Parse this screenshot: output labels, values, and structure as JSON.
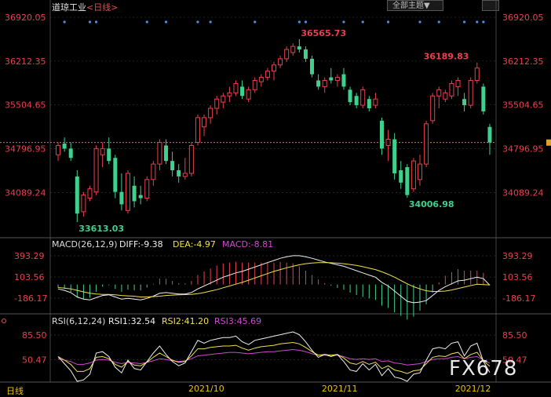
{
  "header": {
    "instrument": "道琼工业",
    "period": "<日线>",
    "theme_button": "全部主题▼"
  },
  "colors": {
    "up": "#e8414e",
    "down": "#3fd08d",
    "price_axis": "#e8414e",
    "grid": "#3a3a3a",
    "dots": "#4a90e2",
    "diff": "#f0f0f0",
    "dea": "#f2e14a",
    "rsi1": "#f0f0f0",
    "rsi2": "#f2e14a",
    "rsi3": "#d04ad0"
  },
  "footer": {
    "period_label": "日线",
    "watermark": "FX678"
  },
  "chart_data": [
    {
      "type": "candlestick",
      "panel": "price",
      "y_ticks": [
        "36920.05",
        "36212.35",
        "35504.65",
        "34796.95",
        "34089.24"
      ],
      "ylim": [
        33500,
        36920
      ],
      "x_ticks": [
        "2021/10",
        "2021/11",
        "2021/12"
      ],
      "last_close": 34897,
      "annotations": [
        {
          "text": "36565.73",
          "index": 38,
          "value": 36565.73,
          "kind": "high"
        },
        {
          "text": "33613.03",
          "index": 3,
          "value": 33613.03,
          "kind": "low"
        },
        {
          "text": "34006.98",
          "index": 55,
          "value": 34006.98,
          "kind": "low"
        },
        {
          "text": "36189.83",
          "index": 65,
          "value": 36189.83,
          "kind": "high"
        }
      ],
      "signal_dots": [
        1,
        5,
        6,
        14,
        17,
        22,
        24,
        31,
        38,
        39,
        45,
        48,
        52,
        57,
        60,
        64,
        66,
        67
      ],
      "candles": [
        {
          "o": 34700,
          "h": 34900,
          "l": 34600,
          "c": 34850
        },
        {
          "o": 34880,
          "h": 34980,
          "l": 34750,
          "c": 34800
        },
        {
          "o": 34800,
          "h": 34900,
          "l": 34600,
          "c": 34650
        },
        {
          "o": 34350,
          "h": 34450,
          "l": 33613,
          "c": 33750
        },
        {
          "o": 33780,
          "h": 34100,
          "l": 33700,
          "c": 34050
        },
        {
          "o": 34000,
          "h": 34200,
          "l": 33950,
          "c": 34150
        },
        {
          "o": 34100,
          "h": 34850,
          "l": 34050,
          "c": 34800
        },
        {
          "o": 34700,
          "h": 34900,
          "l": 34500,
          "c": 34800
        },
        {
          "o": 34800,
          "h": 34980,
          "l": 34550,
          "c": 34600
        },
        {
          "o": 34650,
          "h": 34700,
          "l": 34000,
          "c": 34100
        },
        {
          "o": 34100,
          "h": 34400,
          "l": 33800,
          "c": 33900
        },
        {
          "o": 33800,
          "h": 34450,
          "l": 33750,
          "c": 34400
        },
        {
          "o": 34200,
          "h": 34350,
          "l": 33850,
          "c": 33950
        },
        {
          "o": 34050,
          "h": 34200,
          "l": 33900,
          "c": 34000
        },
        {
          "o": 34000,
          "h": 34350,
          "l": 33950,
          "c": 34300
        },
        {
          "o": 34300,
          "h": 34600,
          "l": 34200,
          "c": 34550
        },
        {
          "o": 34550,
          "h": 34950,
          "l": 34450,
          "c": 34900
        },
        {
          "o": 34850,
          "h": 34950,
          "l": 34550,
          "c": 34600
        },
        {
          "o": 34600,
          "h": 34750,
          "l": 34350,
          "c": 34450
        },
        {
          "o": 34450,
          "h": 34550,
          "l": 34250,
          "c": 34350
        },
        {
          "o": 34350,
          "h": 34650,
          "l": 34300,
          "c": 34400
        },
        {
          "o": 34400,
          "h": 34900,
          "l": 34350,
          "c": 34850
        },
        {
          "o": 34900,
          "h": 35350,
          "l": 34850,
          "c": 35300
        },
        {
          "o": 35150,
          "h": 35350,
          "l": 35000,
          "c": 35300
        },
        {
          "o": 35300,
          "h": 35500,
          "l": 35200,
          "c": 35450
        },
        {
          "o": 35450,
          "h": 35650,
          "l": 35350,
          "c": 35600
        },
        {
          "o": 35550,
          "h": 35700,
          "l": 35450,
          "c": 35650
        },
        {
          "o": 35650,
          "h": 35800,
          "l": 35550,
          "c": 35700
        },
        {
          "o": 35700,
          "h": 35900,
          "l": 35650,
          "c": 35850
        },
        {
          "o": 35800,
          "h": 35900,
          "l": 35600,
          "c": 35650
        },
        {
          "o": 35600,
          "h": 35800,
          "l": 35550,
          "c": 35750
        },
        {
          "o": 35750,
          "h": 35950,
          "l": 35700,
          "c": 35900
        },
        {
          "o": 35880,
          "h": 36000,
          "l": 35800,
          "c": 35950
        },
        {
          "o": 35950,
          "h": 36100,
          "l": 35900,
          "c": 36050
        },
        {
          "o": 36050,
          "h": 36200,
          "l": 35900,
          "c": 36150
        },
        {
          "o": 36150,
          "h": 36300,
          "l": 36100,
          "c": 36250
        },
        {
          "o": 36250,
          "h": 36450,
          "l": 36200,
          "c": 36400
        },
        {
          "o": 36350,
          "h": 36500,
          "l": 36300,
          "c": 36450
        },
        {
          "o": 36450,
          "h": 36565.73,
          "l": 36350,
          "c": 36400
        },
        {
          "o": 36400,
          "h": 36450,
          "l": 36200,
          "c": 36250
        },
        {
          "o": 36250,
          "h": 36300,
          "l": 35950,
          "c": 36000
        },
        {
          "o": 35900,
          "h": 36000,
          "l": 35750,
          "c": 35800
        },
        {
          "o": 35800,
          "h": 35950,
          "l": 35700,
          "c": 35900
        },
        {
          "o": 35950,
          "h": 36100,
          "l": 35850,
          "c": 35900
        },
        {
          "o": 35900,
          "h": 36000,
          "l": 35800,
          "c": 35950
        },
        {
          "o": 36000,
          "h": 36100,
          "l": 35750,
          "c": 35800
        },
        {
          "o": 35750,
          "h": 35800,
          "l": 35500,
          "c": 35550
        },
        {
          "o": 35650,
          "h": 35700,
          "l": 35450,
          "c": 35500
        },
        {
          "o": 35500,
          "h": 35800,
          "l": 35450,
          "c": 35750
        },
        {
          "o": 35600,
          "h": 35650,
          "l": 35400,
          "c": 35450
        },
        {
          "o": 35500,
          "h": 35700,
          "l": 35450,
          "c": 35600
        },
        {
          "o": 35250,
          "h": 35300,
          "l": 34700,
          "c": 34800
        },
        {
          "o": 34850,
          "h": 35100,
          "l": 34600,
          "c": 34950
        },
        {
          "o": 34950,
          "h": 35050,
          "l": 34300,
          "c": 34400
        },
        {
          "o": 34450,
          "h": 34600,
          "l": 34150,
          "c": 34250
        },
        {
          "o": 34500,
          "h": 34550,
          "l": 34006.98,
          "c": 34050
        },
        {
          "o": 34150,
          "h": 34650,
          "l": 34100,
          "c": 34600
        },
        {
          "o": 34300,
          "h": 34700,
          "l": 34200,
          "c": 34550
        },
        {
          "o": 34550,
          "h": 35250,
          "l": 34500,
          "c": 35200
        },
        {
          "o": 35250,
          "h": 35700,
          "l": 35200,
          "c": 35650
        },
        {
          "o": 35650,
          "h": 35800,
          "l": 35450,
          "c": 35750
        },
        {
          "o": 35600,
          "h": 35750,
          "l": 35550,
          "c": 35700
        },
        {
          "o": 35650,
          "h": 35900,
          "l": 35600,
          "c": 35850
        },
        {
          "o": 35800,
          "h": 35950,
          "l": 35650,
          "c": 35900
        },
        {
          "o": 35600,
          "h": 35700,
          "l": 35400,
          "c": 35500
        },
        {
          "o": 35500,
          "h": 35950,
          "l": 35450,
          "c": 35900
        },
        {
          "o": 35900,
          "h": 36189.83,
          "l": 35850,
          "c": 36100
        },
        {
          "o": 35800,
          "h": 35850,
          "l": 35350,
          "c": 35400
        },
        {
          "o": 35150,
          "h": 35200,
          "l": 34700,
          "c": 34897
        }
      ]
    },
    {
      "type": "macd",
      "panel": "macd",
      "label": "MACD(26,12,9)",
      "diff_label": "DIFF:-9.38",
      "dea_label": "DEA:-4.97",
      "macd_label": "MACD:-8.81",
      "y_ticks": [
        "393.29",
        "103.56",
        "-186.17"
      ],
      "ylim": [
        -380,
        480
      ],
      "diff": [
        -60,
        -80,
        -110,
        -170,
        -200,
        -210,
        -180,
        -150,
        -140,
        -170,
        -200,
        -190,
        -200,
        -210,
        -190,
        -160,
        -120,
        -110,
        -120,
        -130,
        -130,
        -110,
        -60,
        -20,
        20,
        60,
        100,
        130,
        160,
        180,
        210,
        240,
        270,
        300,
        330,
        360,
        380,
        395,
        395,
        380,
        360,
        335,
        310,
        290,
        270,
        250,
        220,
        190,
        160,
        130,
        100,
        30,
        -20,
        -90,
        -160,
        -230,
        -250,
        -240,
        -220,
        -150,
        -80,
        -30,
        10,
        50,
        60,
        80,
        100,
        80,
        -9.38
      ],
      "dea": [
        -40,
        -50,
        -60,
        -80,
        -100,
        -120,
        -130,
        -135,
        -135,
        -140,
        -150,
        -155,
        -160,
        -170,
        -170,
        -165,
        -160,
        -150,
        -145,
        -140,
        -138,
        -135,
        -125,
        -110,
        -90,
        -70,
        -45,
        -20,
        5,
        30,
        60,
        90,
        120,
        150,
        180,
        205,
        230,
        250,
        270,
        285,
        295,
        300,
        300,
        298,
        293,
        285,
        275,
        262,
        245,
        225,
        205,
        175,
        140,
        100,
        55,
        10,
        -30,
        -60,
        -85,
        -95,
        -95,
        -90,
        -75,
        -55,
        -35,
        -15,
        5,
        0,
        -4.97
      ]
    },
    {
      "type": "rsi",
      "panel": "rsi",
      "label": "RSI(6,12,24)",
      "rsi1_label": "RSI1:32.54",
      "rsi2_label": "RSI2:41.20",
      "rsi3_label": "RSI3:45.69",
      "y_ticks": [
        "85.50",
        "50.47"
      ],
      "ylim": [
        20,
        100
      ],
      "rsi1": [
        55,
        45,
        35,
        20,
        22,
        30,
        60,
        62,
        55,
        40,
        32,
        50,
        38,
        36,
        48,
        60,
        70,
        58,
        48,
        42,
        46,
        62,
        78,
        74,
        78,
        80,
        82,
        82,
        84,
        76,
        72,
        78,
        80,
        82,
        84,
        86,
        88,
        90,
        86,
        76,
        64,
        54,
        58,
        55,
        58,
        48,
        36,
        34,
        45,
        36,
        44,
        28,
        38,
        26,
        24,
        20,
        30,
        32,
        50,
        66,
        68,
        66,
        74,
        76,
        56,
        70,
        74,
        48,
        32.54
      ],
      "rsi2": [
        55,
        50,
        44,
        34,
        34,
        38,
        54,
        55,
        52,
        44,
        40,
        48,
        43,
        42,
        47,
        54,
        60,
        55,
        50,
        47,
        48,
        56,
        66,
        66,
        68,
        69,
        70,
        70,
        71,
        67,
        64,
        67,
        69,
        70,
        71,
        73,
        74,
        75,
        73,
        68,
        62,
        57,
        58,
        57,
        58,
        53,
        46,
        44,
        48,
        44,
        47,
        38,
        42,
        36,
        34,
        31,
        35,
        36,
        45,
        54,
        56,
        55,
        59,
        61,
        52,
        58,
        61,
        49,
        41.2
      ],
      "rsi3": [
        52,
        50,
        48,
        44,
        44,
        46,
        50,
        51,
        50,
        47,
        45,
        47,
        46,
        45,
        47,
        49,
        52,
        51,
        49,
        48,
        49,
        52,
        56,
        57,
        58,
        59,
        60,
        61,
        61,
        60,
        59,
        60,
        61,
        62,
        62,
        63,
        64,
        65,
        64,
        62,
        59,
        57,
        57,
        57,
        57,
        55,
        52,
        51,
        52,
        51,
        52,
        48,
        49,
        46,
        45,
        43,
        44,
        45,
        48,
        51,
        52,
        52,
        54,
        55,
        52,
        54,
        55,
        50,
        45.69
      ]
    }
  ]
}
